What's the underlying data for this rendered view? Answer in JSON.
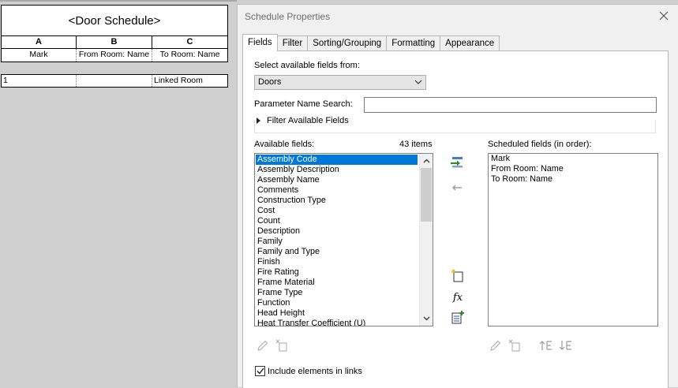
{
  "schedule": {
    "title": "<Door Schedule>",
    "column_letters": [
      "A",
      "B",
      "C"
    ],
    "headers": [
      "Mark",
      "From Room: Name",
      "To Room: Name"
    ],
    "rows": [
      [
        "1",
        "",
        "Linked Room"
      ]
    ]
  },
  "dialog": {
    "title": "Schedule Properties",
    "tabs": [
      "Fields",
      "Filter",
      "Sorting/Grouping",
      "Formatting",
      "Appearance"
    ],
    "active_tab": "Fields",
    "select_from_label": "Select available fields from:",
    "select_from_value": "Doors",
    "param_search_label": "Parameter Name Search:",
    "param_search_value": "",
    "filter_label": "Filter Available Fields",
    "available_label": "Available fields:",
    "available_count": "43 items",
    "available_fields": [
      "Assembly Code",
      "Assembly Description",
      "Assembly Name",
      "Comments",
      "Construction Type",
      "Cost",
      "Count",
      "Description",
      "Family",
      "Family and Type",
      "Finish",
      "Fire Rating",
      "Frame Material",
      "Frame Type",
      "Function",
      "Head Height",
      "Heat Transfer Coefficient (U)"
    ],
    "selected_field": "Assembly Code",
    "scheduled_label": "Scheduled fields (in order):",
    "scheduled_fields": [
      "Mark",
      "From Room: Name",
      "To Room: Name"
    ],
    "include_links_label": "Include elements in links",
    "include_links_checked": true,
    "fx_symbol": "fx",
    "colors": {
      "selection": "#0078d7",
      "add_arrow": "#2e8b2e",
      "panel": "#ffffff",
      "background": "#f0f0f0"
    }
  }
}
